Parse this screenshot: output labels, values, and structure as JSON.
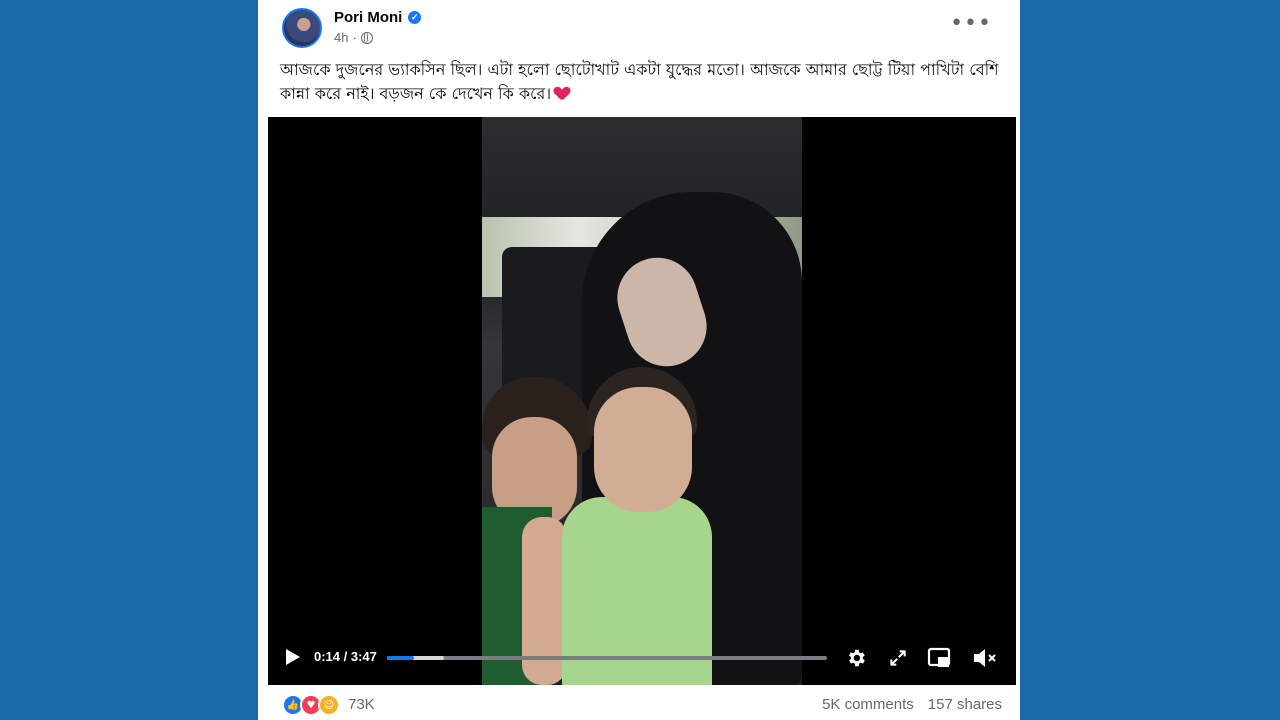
{
  "post": {
    "author": "Pori Moni",
    "time": "4h",
    "dot": "·",
    "caption": "আজকে দুজনের ভ্যাকসিন ছিল। এটা হলো ছোটোখাট একটা যুদ্ধের মতো। আজকে আমার ছোট্ট টিয়া পাখিটা বেশি কান্না করে নাই। বড়জন কে দেখেন কি করে।",
    "more_label": "•••"
  },
  "video": {
    "time_display": "0:14 / 3:47",
    "progress": 0.062,
    "buffered": 0.13
  },
  "footer": {
    "reaction_count": "73K",
    "comments": "5K comments",
    "shares": "157 shares"
  },
  "colors": {
    "background": "#1b6aa8",
    "accent": "#1877f2",
    "love": "#f33e58"
  },
  "icons": [
    "verified-icon",
    "globe-icon",
    "more-icon",
    "play-icon",
    "settings-icon",
    "fullscreen-icon",
    "pip-icon",
    "mute-icon",
    "like-icon",
    "love-icon",
    "care-icon"
  ]
}
